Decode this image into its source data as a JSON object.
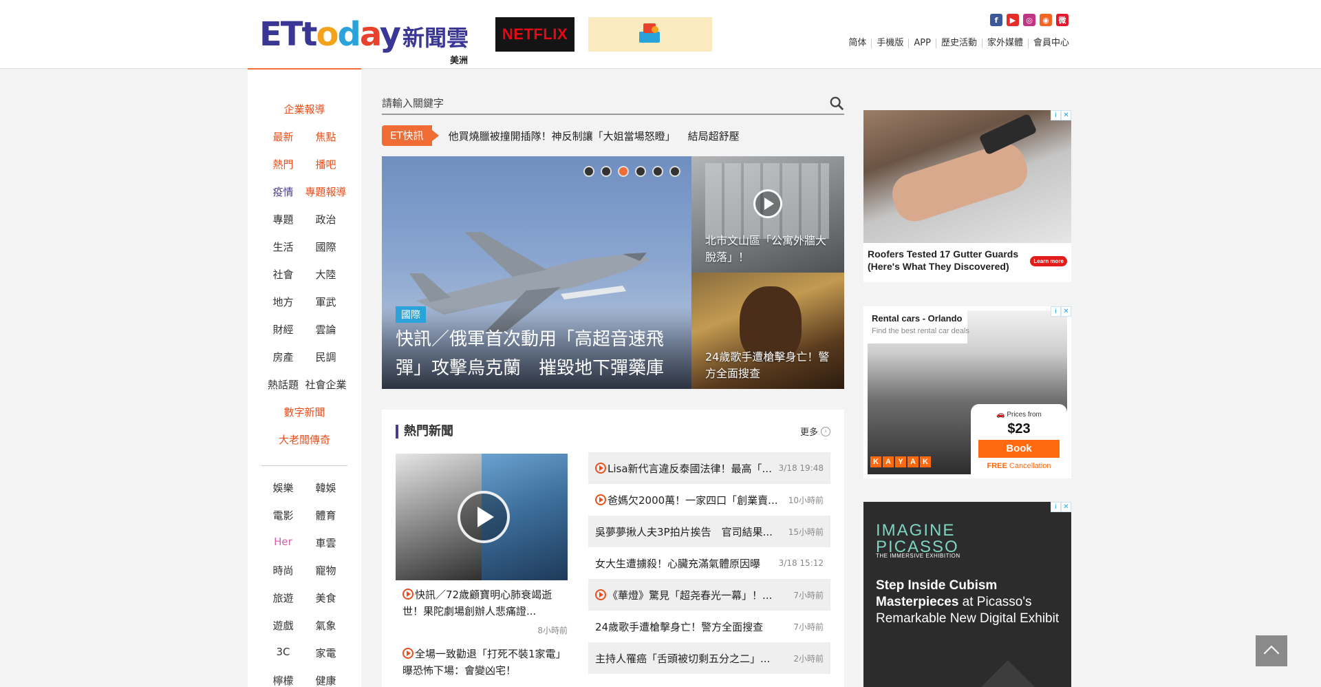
{
  "header": {
    "logo_et": [
      "ET",
      "t",
      "o",
      "d",
      "a",
      "y"
    ],
    "logo_cn": "新聞雲",
    "region": "美洲",
    "netflix": "NETFLIX",
    "social": [
      "facebook-icon",
      "youtube-icon",
      "instagram-icon",
      "rss-icon",
      "weibo-icon"
    ],
    "topnav": [
      "简体",
      "手機版",
      "APP",
      "歷史活動",
      "家外媒體",
      "會員中心"
    ]
  },
  "sidebar": {
    "rows": [
      {
        "items": [
          {
            "label": "企業報導",
            "color": "orange"
          }
        ]
      },
      {
        "items": [
          {
            "label": "最新",
            "color": "orange"
          },
          {
            "label": "焦點",
            "color": "orange"
          }
        ]
      },
      {
        "items": [
          {
            "label": "熱門",
            "color": "orange"
          },
          {
            "label": "播吧",
            "color": "orange"
          }
        ]
      },
      {
        "items": [
          {
            "label": "疫情",
            "color": "purple"
          },
          {
            "label": "專題報導",
            "color": "orange"
          }
        ]
      },
      {
        "items": [
          {
            "label": "專題",
            "color": "dark"
          },
          {
            "label": "政治",
            "color": "dark"
          }
        ]
      },
      {
        "items": [
          {
            "label": "生活",
            "color": "dark"
          },
          {
            "label": "國際",
            "color": "dark"
          }
        ]
      },
      {
        "items": [
          {
            "label": "社會",
            "color": "dark"
          },
          {
            "label": "大陸",
            "color": "dark"
          }
        ]
      },
      {
        "items": [
          {
            "label": "地方",
            "color": "dark"
          },
          {
            "label": "軍武",
            "color": "dark"
          }
        ]
      },
      {
        "items": [
          {
            "label": "財經",
            "color": "dark"
          },
          {
            "label": "雲論",
            "color": "dark"
          }
        ]
      },
      {
        "items": [
          {
            "label": "房產",
            "color": "dark"
          },
          {
            "label": "民調",
            "color": "dark"
          }
        ]
      },
      {
        "items": [
          {
            "label": "熱話題",
            "color": "dark"
          },
          {
            "label": "社會企業",
            "color": "dark"
          }
        ]
      },
      {
        "items": [
          {
            "label": "數字新聞",
            "color": "orange"
          }
        ]
      },
      {
        "items": [
          {
            "label": "大老闆傳奇",
            "color": "orange"
          }
        ]
      }
    ],
    "rows2": [
      {
        "items": [
          {
            "label": "娛樂",
            "color": "dark"
          },
          {
            "label": "韓娛",
            "color": "dark"
          }
        ]
      },
      {
        "items": [
          {
            "label": "電影",
            "color": "dark"
          },
          {
            "label": "體育",
            "color": "dark"
          }
        ]
      },
      {
        "items": [
          {
            "label": "Her",
            "color": "pink"
          },
          {
            "label": "車雲",
            "color": "dark"
          }
        ]
      },
      {
        "items": [
          {
            "label": "時尚",
            "color": "dark"
          },
          {
            "label": "寵物",
            "color": "dark"
          }
        ]
      },
      {
        "items": [
          {
            "label": "旅遊",
            "color": "dark"
          },
          {
            "label": "美食",
            "color": "dark"
          }
        ]
      },
      {
        "items": [
          {
            "label": "遊戲",
            "color": "dark"
          },
          {
            "label": "氣象",
            "color": "dark"
          }
        ]
      },
      {
        "items": [
          {
            "label": "3C",
            "color": "dark"
          },
          {
            "label": "家電",
            "color": "dark"
          }
        ]
      },
      {
        "items": [
          {
            "label": "檸檬",
            "color": "dark"
          },
          {
            "label": "健康",
            "color": "dark"
          }
        ]
      }
    ]
  },
  "search": {
    "placeholder": "請輸入關鍵字"
  },
  "ticker": {
    "label": "ET快訊",
    "items": [
      "他買燒臘被撞開插隊！神反制讓「大姐當場怒瞪」",
      "結局超舒壓"
    ]
  },
  "hero": {
    "tag": "國際",
    "title": "快訊／俄軍首次動用「高超音速飛彈」攻擊烏克蘭　摧毀地下彈藥庫",
    "dots": 6,
    "active_dot": 3
  },
  "side_news": [
    {
      "title": "北市文山區「公寓外牆大脫落」！"
    },
    {
      "title": "24歲歌手遭槍擊身亡！警方全面搜查"
    }
  ],
  "hot": {
    "title": "熱門新聞",
    "more": "更多",
    "left_items": [
      {
        "title": "快訊／72歲顧寶明心肺衰竭逝世！果陀劇場創辦人悲痛證...",
        "time": "8小時前"
      },
      {
        "title": "全場一致勸退「打死不裝1家電」　曝恐怖下場：會變凶宅！",
        "time": ""
      }
    ],
    "list": [
      {
        "title": "Lisa新代言違反泰國法律！最高「...",
        "time": "3/18 19:48",
        "video": true
      },
      {
        "title": "爸媽欠2000萬！一家四口「創業賣...",
        "time": "10小時前",
        "video": true
      },
      {
        "title": "吳夢夢揪人夫3P拍片挨告　官司結果...",
        "time": "15小時前",
        "video": false
      },
      {
        "title": "女大生遭擄殺！心臟充滿氣體原因曝",
        "time": "3/18 15:12",
        "video": false
      },
      {
        "title": "《華燈》驚見「超尧春光一幕」！...",
        "time": "7小時前",
        "video": true
      },
      {
        "title": "24歲歌手遭槍擊身亡！警方全面搜查",
        "time": "7小時前",
        "video": false
      },
      {
        "title": "主持人罹癌「舌頭被切剩五分之二」...",
        "time": "2小時前",
        "video": false
      }
    ]
  },
  "ads": {
    "ad1": {
      "text_line1": "Roofers Tested 17 Gutter Guards",
      "text_line2": "(Here's What They Discovered)",
      "cta": "Learn more"
    },
    "ad2": {
      "title": "Rental cars - Orlando",
      "sub": "Find the best rental car deals",
      "brand": [
        "K",
        "A",
        "Y",
        "A",
        "K"
      ],
      "prices_from": "Prices from",
      "price": "$23",
      "book": "Book",
      "free": "FREE",
      "cancel": "Cancellation"
    },
    "ad3": {
      "line1": "IMAGINE",
      "line2": "PICASSO",
      "tag": "THE IMMERSIVE EXHIBITION",
      "copy_bold": "Step Inside Cubism Masterpieces",
      "copy_rest": " at Picasso's Remarkable New Digital Exhibit"
    }
  }
}
